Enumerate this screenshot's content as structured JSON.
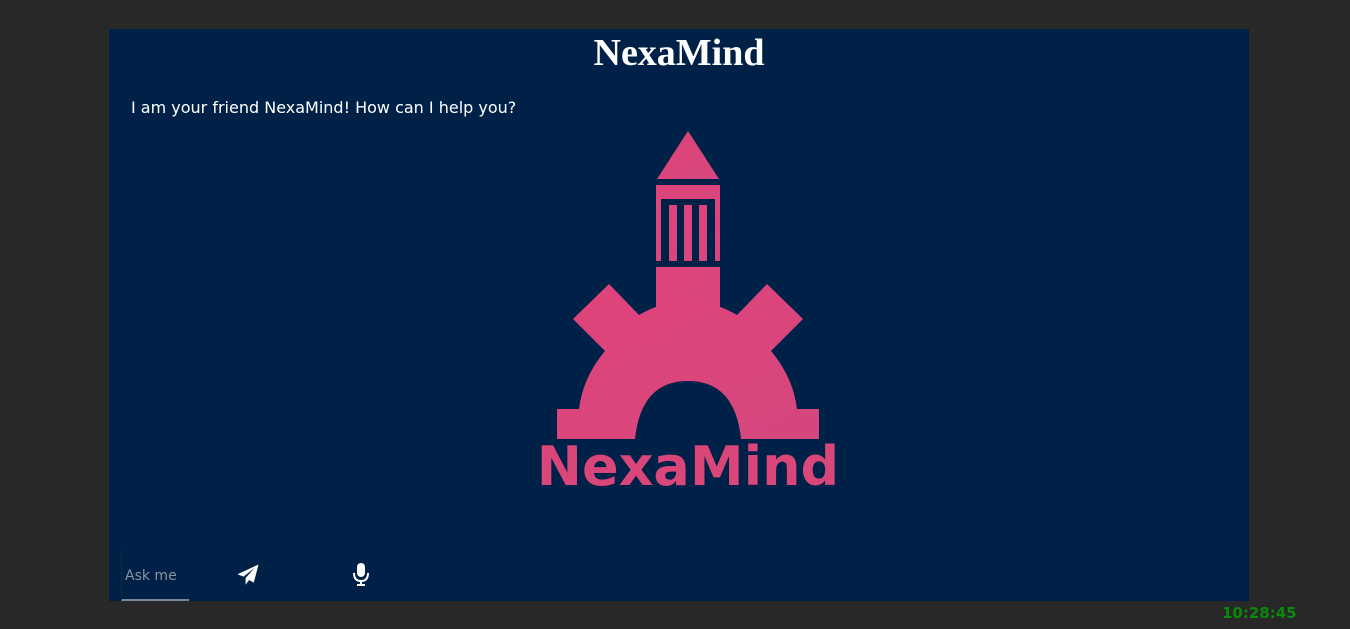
{
  "header": {
    "title": "NexaMind"
  },
  "chat": {
    "bot_message": "I am your friend NexaMind! How can I help you?"
  },
  "logo": {
    "wordmark": "NexaMind",
    "color": "#d9467a"
  },
  "composer": {
    "placeholder": "Ask me",
    "value": "",
    "send_icon": "paper-plane-icon",
    "mic_icon": "microphone-icon"
  },
  "status": {
    "clock": "10:28:45"
  },
  "colors": {
    "page_bg": "#282828",
    "panel_bg": "#002147",
    "text": "#ffffff",
    "clock": "#0a8a0a"
  }
}
